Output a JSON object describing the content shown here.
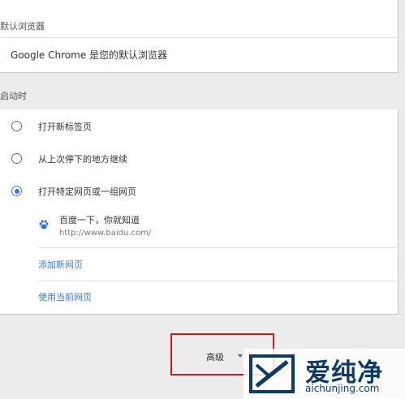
{
  "default_browser": {
    "label": "默认浏览器",
    "status": "Google Chrome 是您的默认浏览器"
  },
  "on_startup": {
    "label": "启动时",
    "options": [
      {
        "label": "打开新标签页",
        "checked": false
      },
      {
        "label": "从上次停下的地方继续",
        "checked": false
      },
      {
        "label": "打开特定网页或一组网页",
        "checked": true
      }
    ],
    "site": {
      "title": "百度一下，你就知道",
      "url": "http://www.baidu.com/"
    },
    "add_page": "添加新网页",
    "use_current": "使用当前网页"
  },
  "advanced": {
    "label": "高级"
  },
  "watermark": {
    "text": "爱纯净",
    "url": "aichunjing.com"
  },
  "colors": {
    "accent": "#3b78e7",
    "highlight": "#d0191c",
    "watermark": "#0d3a66"
  }
}
